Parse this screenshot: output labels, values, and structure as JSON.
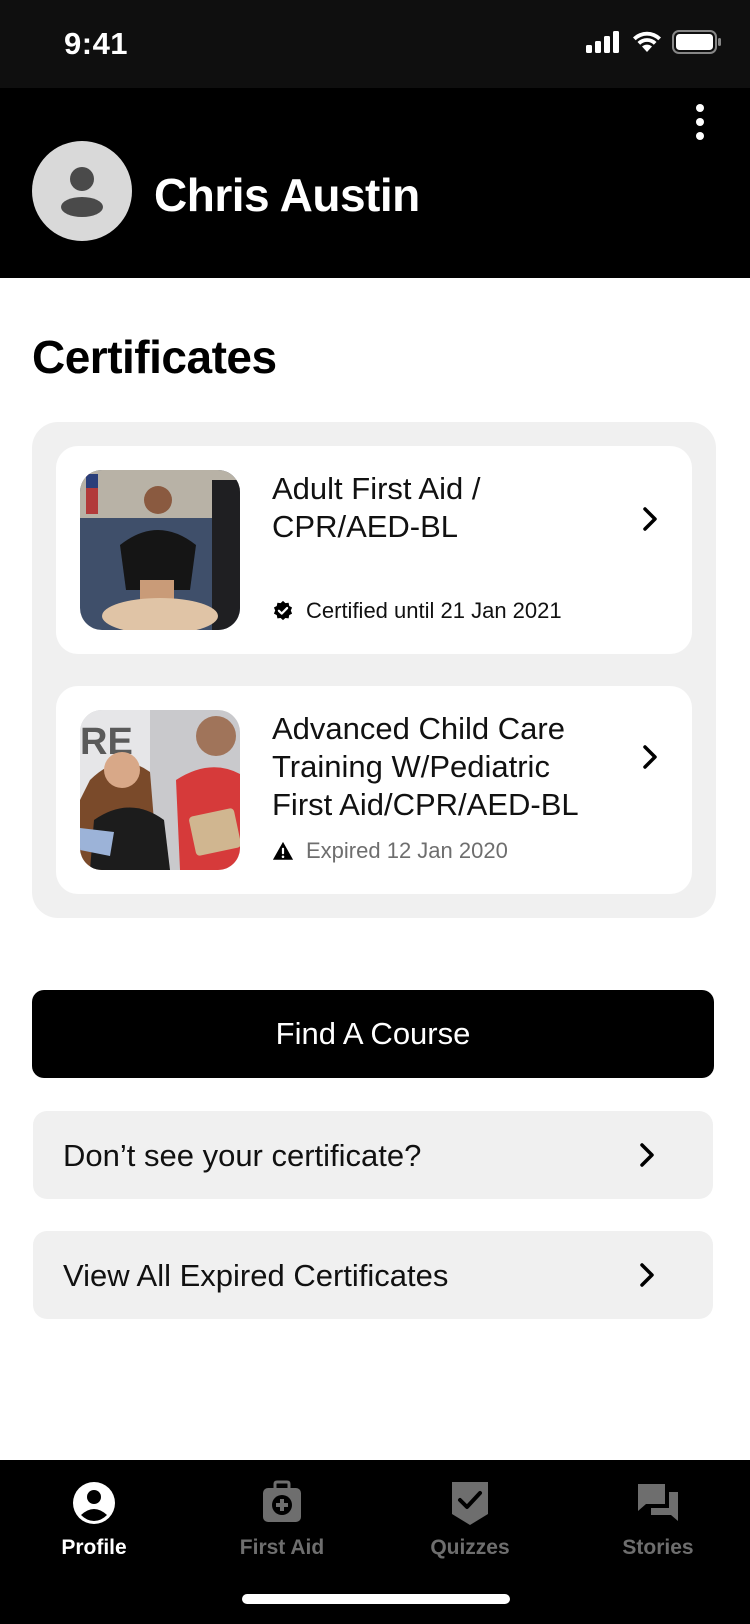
{
  "status_bar": {
    "time": "9:41"
  },
  "profile": {
    "name": "Chris Austin"
  },
  "certificates": {
    "title": "Certificates",
    "items": [
      {
        "title": "Adult First Aid / CPR/AED-BL",
        "status": "Certified until 21 Jan 2021",
        "state": "certified"
      },
      {
        "title": "Advanced Child Care Training W/Pediatric First Aid/CPR/AED-BL",
        "status": "Expired 12 Jan 2020",
        "state": "expired"
      }
    ]
  },
  "actions": {
    "find_course": "Find A Course",
    "missing_certificate": "Don’t see your certificate?",
    "view_expired": "View All Expired Certificates"
  },
  "tabs": [
    {
      "label": "Profile",
      "icon": "profile-icon",
      "active": true
    },
    {
      "label": "First Aid",
      "icon": "first-aid-kit-icon",
      "active": false
    },
    {
      "label": "Quizzes",
      "icon": "quiz-check-icon",
      "active": false
    },
    {
      "label": "Stories",
      "icon": "stories-chat-icon",
      "active": false
    }
  ],
  "colors": {
    "header": "#000000",
    "panel": "#f0f0f0",
    "inactive_tab": "#6e6e6e",
    "expired_text": "#6e6e6e"
  }
}
